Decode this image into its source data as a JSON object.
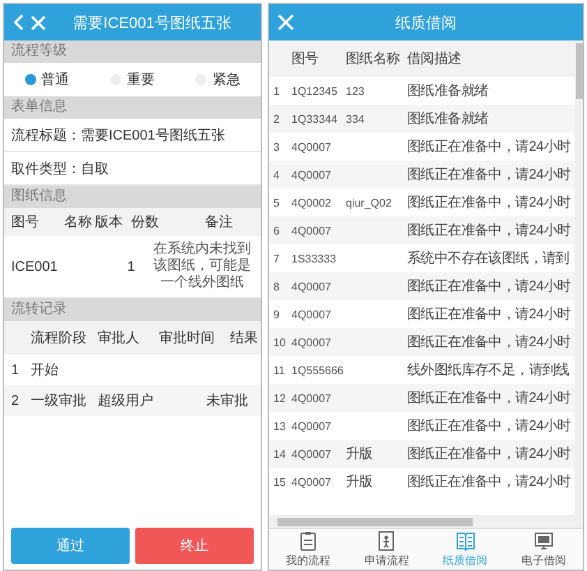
{
  "left": {
    "header": {
      "title": "需要ICE001号图纸五张"
    },
    "priority": {
      "heading": "流程等级",
      "options": [
        {
          "label": "普通",
          "selected": true
        },
        {
          "label": "重要",
          "selected": false
        },
        {
          "label": "紧急",
          "selected": false
        }
      ]
    },
    "form": {
      "heading": "表单信息",
      "fields": [
        {
          "text": "流程标题：需要ICE001号图纸五张"
        },
        {
          "text": "取件类型：自取"
        }
      ]
    },
    "drawings": {
      "heading": "图纸信息",
      "columns": [
        "图号",
        "名称",
        "版本",
        "份数",
        "备注"
      ],
      "rows": [
        {
          "code": "ICE001",
          "copies": "1",
          "remark": "在系统内未找到该图纸，可能是一个线外图纸"
        }
      ]
    },
    "flow": {
      "heading": "流转记录",
      "columns": [
        "流程阶段",
        "审批人",
        "审批时间",
        "结果"
      ],
      "rows": [
        {
          "index": "1",
          "stage": "开始"
        },
        {
          "index": "2",
          "stage": "一级审批",
          "approver": "超级用户",
          "result": "未审批"
        }
      ]
    },
    "buttons": [
      {
        "label": "通过",
        "kind": "approve"
      },
      {
        "label": "终止",
        "kind": "terminate"
      }
    ]
  },
  "right": {
    "header": {
      "title": "纸质借阅"
    },
    "table": {
      "columns": [
        "图号",
        "图纸名称",
        "借阅描述"
      ],
      "rows": [
        {
          "index": "1",
          "code": "1Q12345",
          "name": "123",
          "description": "图纸准备就绪"
        },
        {
          "index": "2",
          "code": "1Q33344",
          "name": "334",
          "description": "图纸准备就绪"
        },
        {
          "index": "3",
          "code": "4Q0007",
          "description": "图纸正在准备中，请24小时"
        },
        {
          "index": "4",
          "code": "4Q0007",
          "description": "图纸正在准备中，请24小时"
        },
        {
          "index": "5",
          "code": "4Q0002",
          "name": "qiur_Q02",
          "description": "图纸正在准备中，请24小时"
        },
        {
          "index": "6",
          "code": "4Q0007",
          "description": "图纸正在准备中，请24小时"
        },
        {
          "index": "7",
          "code": "1S33333",
          "description": "系统中不存在该图纸，请到"
        },
        {
          "index": "8",
          "code": "4Q0007",
          "description": "图纸正在准备中，请24小时"
        },
        {
          "index": "9",
          "code": "4Q0007",
          "description": "图纸正在准备中，请24小时"
        },
        {
          "index": "10",
          "code": "4Q0007",
          "description": "图纸正在准备中，请24小时"
        },
        {
          "index": "11",
          "code": "1Q555666",
          "description": "线外图纸库存不足，请到线"
        },
        {
          "index": "12",
          "code": "4Q0007",
          "description": "图纸正在准备中，请24小时"
        },
        {
          "index": "13",
          "code": "4Q0007",
          "description": "图纸正在准备中，请24小时"
        },
        {
          "index": "14",
          "code": "4Q0007",
          "name": "升版",
          "description": "图纸正在准备中，请24小时"
        },
        {
          "index": "15",
          "code": "4Q0007",
          "name": "升版",
          "description": "图纸正在准备中，请24小时"
        }
      ]
    },
    "tab_bar": [
      {
        "label": "我的流程",
        "selected": false
      },
      {
        "label": "申请流程",
        "selected": false
      },
      {
        "label": "纸质借阅",
        "selected": true
      },
      {
        "label": "电子借阅",
        "selected": false
      }
    ]
  }
}
